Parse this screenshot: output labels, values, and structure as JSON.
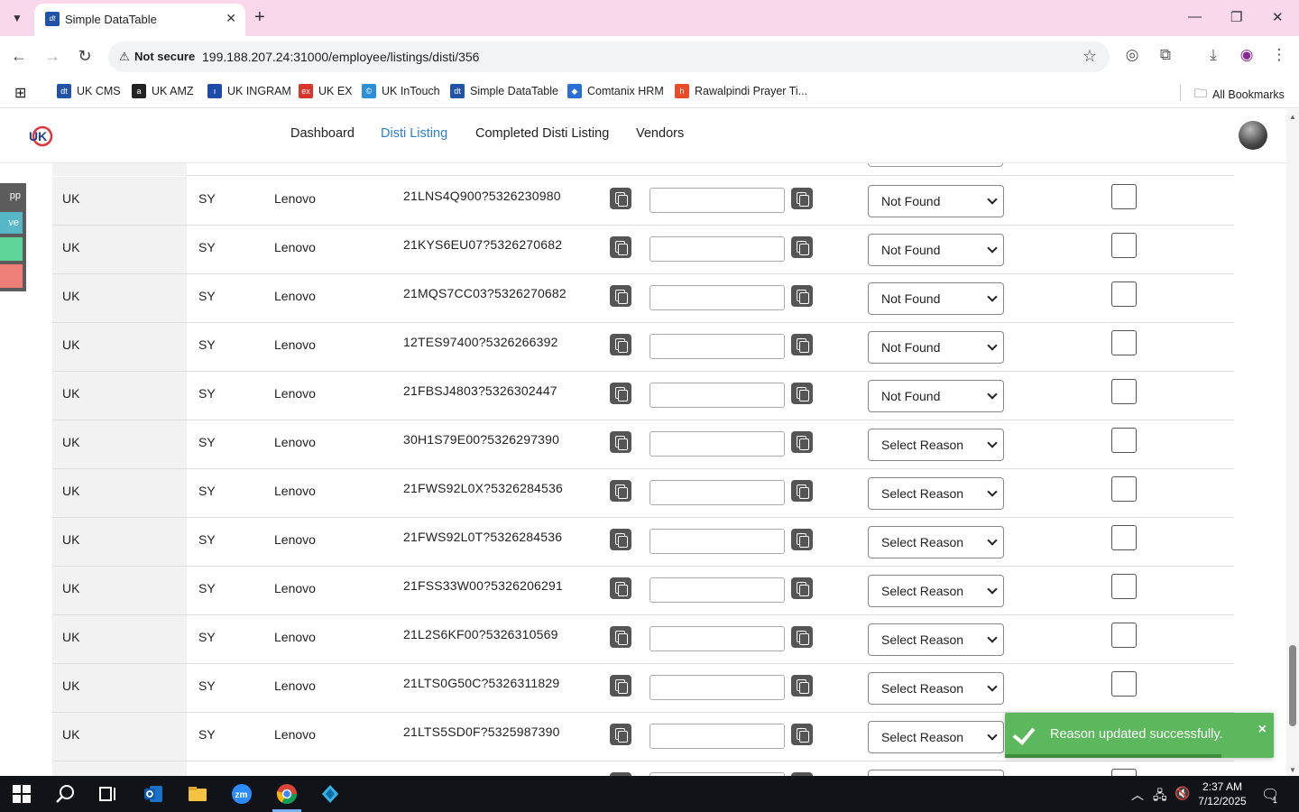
{
  "browser": {
    "tab_title": "Simple DataTable",
    "favicon_text": "dt",
    "security_label": "Not secure",
    "url": "199.188.207.24:31000/employee/listings/disti/356",
    "window_controls": [
      "minimize-icon",
      "maximize-icon",
      "close-icon"
    ],
    "new_tab": "+"
  },
  "bookmarks": {
    "items": [
      {
        "label": "UK CMS",
        "icon_color": "#2153a8",
        "icon_text": "dt"
      },
      {
        "label": "UK AMZ",
        "icon_color": "#222222",
        "icon_text": "a"
      },
      {
        "label": "UK INGRAM",
        "icon_color": "#1f4aa8",
        "icon_text": "ı"
      },
      {
        "label": "UK EX",
        "icon_color": "#d9362b",
        "icon_text": "ex"
      },
      {
        "label": "UK InTouch",
        "icon_color": "#2a8fd8",
        "icon_text": "©"
      },
      {
        "label": "Simple DataTable",
        "icon_color": "#2153a8",
        "icon_text": "dt"
      },
      {
        "label": "Comtanix HRM",
        "icon_color": "#2a6fd8",
        "icon_text": "◆"
      },
      {
        "label": "Rawalpindi Prayer Ti...",
        "icon_color": "#e84a2a",
        "icon_text": "h"
      }
    ],
    "all_bookmarks": "All Bookmarks"
  },
  "app": {
    "nav": {
      "dashboard": "Dashboard",
      "disti_listing": "Disti Listing",
      "completed": "Completed Disti Listing",
      "vendors": "Vendors"
    },
    "accent": "#2a7fd8"
  },
  "left_rail": {
    "item1": "pp ↗",
    "item2": "ve"
  },
  "rows": [
    {
      "country": "UK",
      "code": "SY",
      "brand": "Lenovo",
      "part": "21LNS4Q900?5326230980",
      "reason": "Not Found"
    },
    {
      "country": "UK",
      "code": "SY",
      "brand": "Lenovo",
      "part": "21KYS6EU07?5326270682",
      "reason": "Not Found"
    },
    {
      "country": "UK",
      "code": "SY",
      "brand": "Lenovo",
      "part": "21MQS7CC03?5326270682",
      "reason": "Not Found"
    },
    {
      "country": "UK",
      "code": "SY",
      "brand": "Lenovo",
      "part": "12TES97400?5326266392",
      "reason": "Not Found"
    },
    {
      "country": "UK",
      "code": "SY",
      "brand": "Lenovo",
      "part": "21FBSJ4803?5326302447",
      "reason": "Not Found"
    },
    {
      "country": "UK",
      "code": "SY",
      "brand": "Lenovo",
      "part": "30H1S79E00?5326297390",
      "reason": "Select Reason"
    },
    {
      "country": "UK",
      "code": "SY",
      "brand": "Lenovo",
      "part": "21FWS92L0X?5326284536",
      "reason": "Select Reason"
    },
    {
      "country": "UK",
      "code": "SY",
      "brand": "Lenovo",
      "part": "21FWS92L0T?5326284536",
      "reason": "Select Reason"
    },
    {
      "country": "UK",
      "code": "SY",
      "brand": "Lenovo",
      "part": "21FSS33W00?5326206291",
      "reason": "Select Reason"
    },
    {
      "country": "UK",
      "code": "SY",
      "brand": "Lenovo",
      "part": "21L2S6KF00?5326310569",
      "reason": "Select Reason"
    },
    {
      "country": "UK",
      "code": "SY",
      "brand": "Lenovo",
      "part": "21LTS0G50C?5326311829",
      "reason": "Select Reason"
    },
    {
      "country": "UK",
      "code": "SY",
      "brand": "Lenovo",
      "part": "21LTS5SD0F?5325987390",
      "reason": "Select Reason"
    }
  ],
  "toast": {
    "message": "Reason updated successfully.",
    "close": "×",
    "color": "#5cb85c"
  },
  "taskbar": {
    "time": "2:37 AM",
    "date": "7/12/2025",
    "notification_count": "1"
  }
}
